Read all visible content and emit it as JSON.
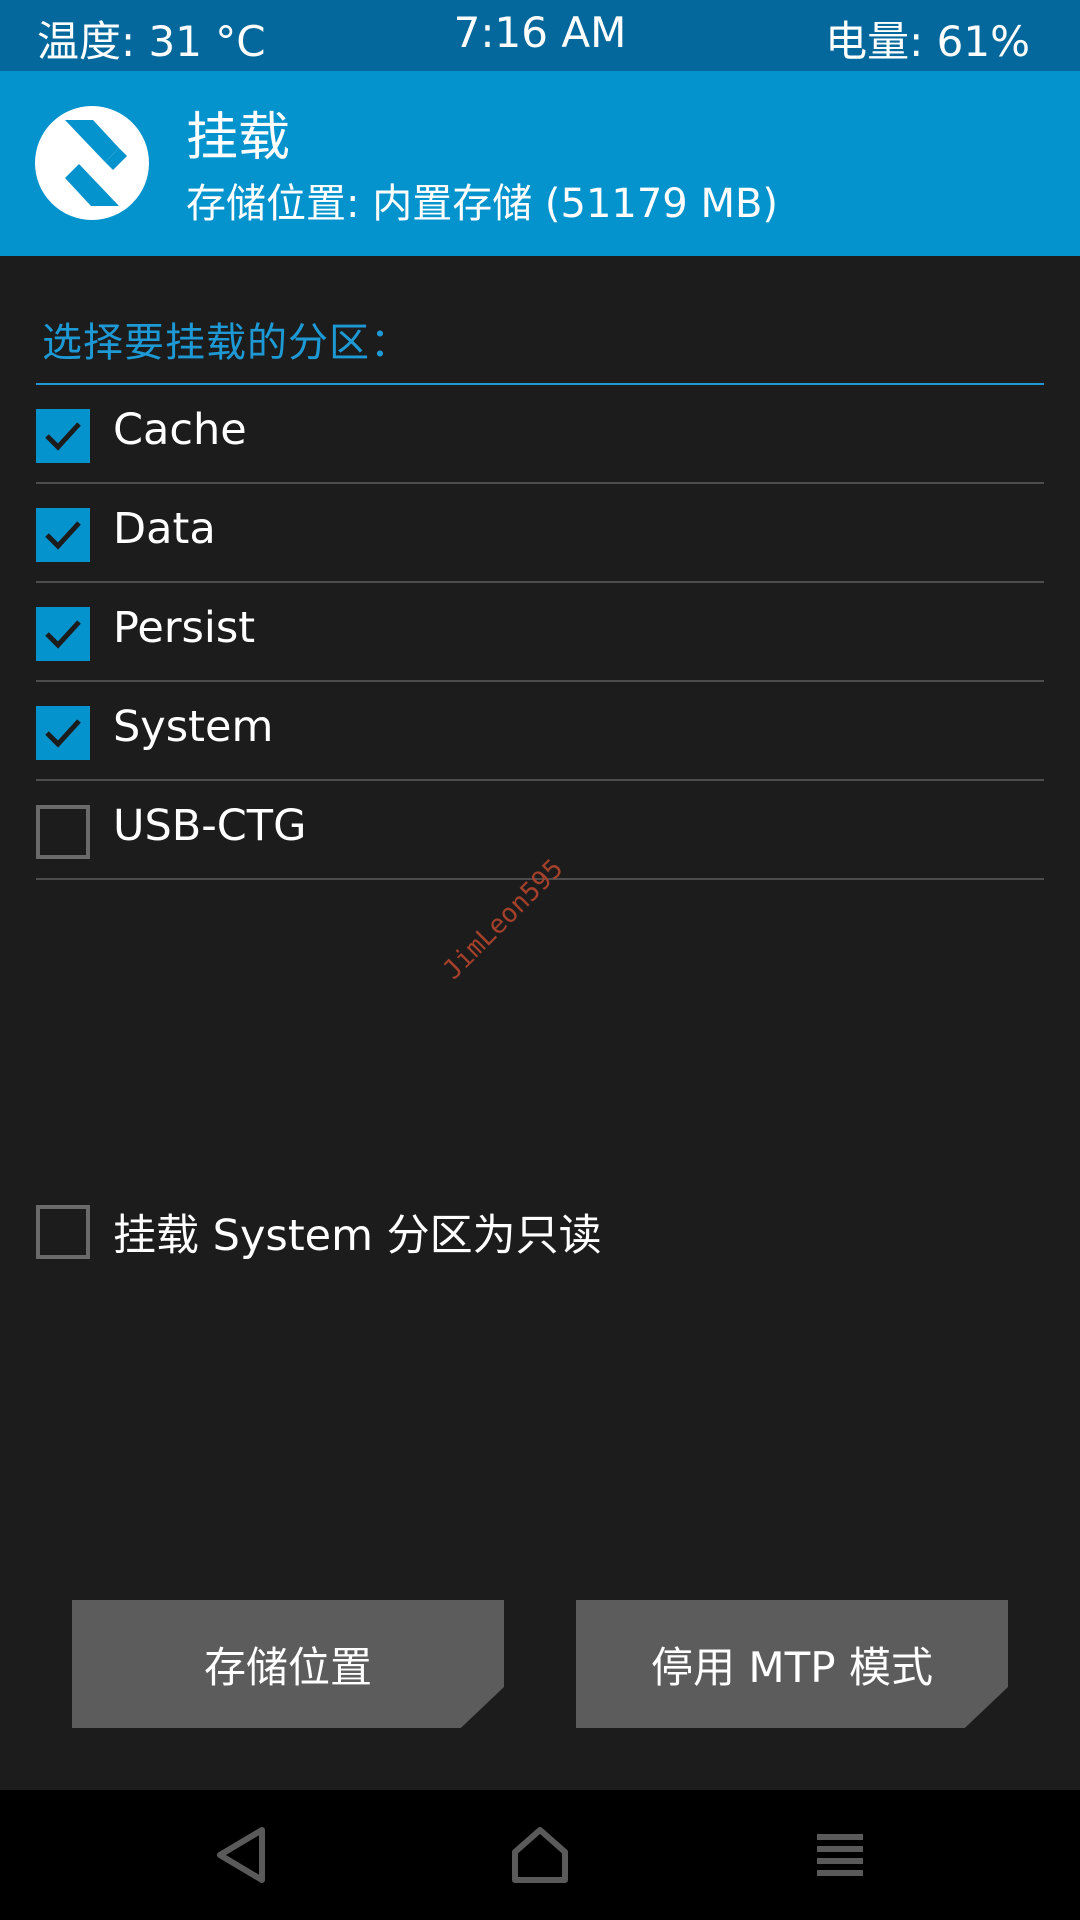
{
  "status_bar": {
    "temperature": "温度: 31 °C",
    "time": "7:16 AM",
    "battery": "电量: 61%"
  },
  "header": {
    "title": "挂载",
    "subtitle": "存储位置: 内置存储 (51179 MB)",
    "logo_icon": "twrp-logo-icon"
  },
  "section": {
    "label": "选择要挂载的分区："
  },
  "partitions": [
    {
      "label": "Cache",
      "checked": true
    },
    {
      "label": "Data",
      "checked": true
    },
    {
      "label": "Persist",
      "checked": true
    },
    {
      "label": "System",
      "checked": true
    },
    {
      "label": "USB-CTG",
      "checked": false
    }
  ],
  "watermark": "JimLeon595",
  "readonly_option": {
    "label": "挂载 System 分区为只读",
    "checked": false
  },
  "buttons": {
    "storage": "存储位置",
    "mtp": "停用 MTP 模式"
  },
  "nav": {
    "back_icon": "back-triangle-icon",
    "home_icon": "home-icon",
    "menu_icon": "menu-lines-icon"
  },
  "colors": {
    "status_bar": "#04689c",
    "header": "#0493cd",
    "accent": "#1d9ad6",
    "background": "#1c1c1c",
    "button": "#5c5c5c"
  }
}
